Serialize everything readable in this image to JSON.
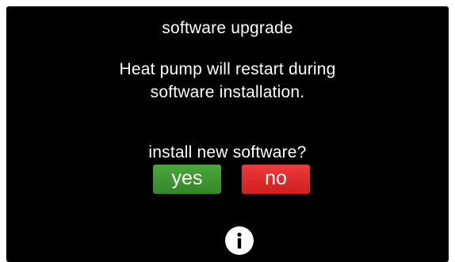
{
  "dialog": {
    "title": "software upgrade",
    "message_line1": "Heat pump will restart during",
    "message_line2": "software installation.",
    "question": "install new software?",
    "yes_label": "yes",
    "no_label": "no",
    "info_icon": "info-icon"
  },
  "colors": {
    "background": "#000000",
    "text": "#ffffff",
    "yes_button": "#3f9a33",
    "no_button": "#e02a2a",
    "info_circle": "#ffffff"
  }
}
